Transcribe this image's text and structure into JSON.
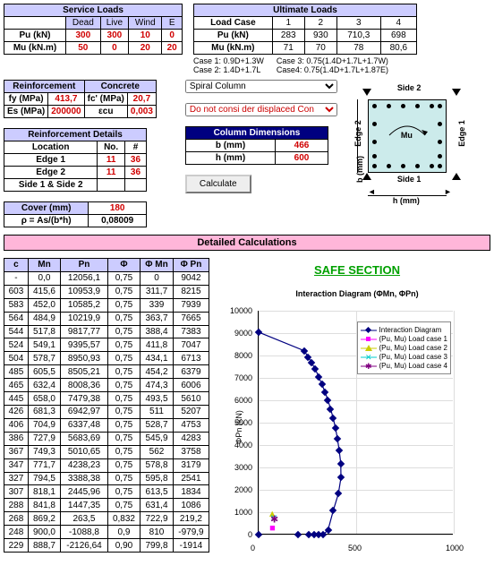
{
  "service": {
    "title": "Service Loads",
    "cols": [
      "Dead",
      "Live",
      "Wind",
      "E"
    ],
    "rows": [
      {
        "k": "Pu (kN)",
        "v": [
          "300",
          "300",
          "10",
          "0"
        ]
      },
      {
        "k": "Mu (kN.m)",
        "v": [
          "50",
          "0",
          "20",
          "20"
        ]
      }
    ]
  },
  "ultimate": {
    "title": "Ultimate Loads",
    "head": "Load Case",
    "cases": [
      "1",
      "2",
      "3",
      "4"
    ],
    "rows": [
      {
        "k": "Pu (kN)",
        "v": [
          "283",
          "930",
          "710,3",
          "698"
        ]
      },
      {
        "k": "Mu (kN.m)",
        "v": [
          "71",
          "70",
          "78",
          "80,6"
        ]
      }
    ]
  },
  "caselbl": [
    {
      "a": "Case 1:",
      "b": "0.9D+1.3W"
    },
    {
      "a": "Case 2:",
      "b": "1.4D+1.7L"
    },
    {
      "a": "Case 3:",
      "b": "0.75(1.4D+1.7L+1.7W)"
    },
    {
      "a": "Case4:",
      "b": "0.75(1.4D+1.7L+1.87E)"
    }
  ],
  "reinf": {
    "t": "Reinforcement",
    "fy": {
      "k": "fy (MPa)",
      "v": "413,7"
    },
    "es": {
      "k": "Es (MPa)",
      "v": "200000"
    }
  },
  "conc": {
    "t": "Concrete",
    "fc": {
      "k": "fc' (MPa)",
      "v": "20,7"
    },
    "ecu": {
      "k": "εcu",
      "v": "0,003"
    }
  },
  "rdet": {
    "t": "Reinforcement Details",
    "h": [
      "Location",
      "No.",
      "#"
    ],
    "rows": [
      {
        "k": "Edge 1",
        "n": "11",
        "d": "36"
      },
      {
        "k": "Edge 2",
        "n": "11",
        "d": "36"
      },
      {
        "k": "Side 1 & Side 2",
        "n": "",
        "d": ""
      }
    ]
  },
  "cover": {
    "k": "Cover (mm)",
    "v": "180"
  },
  "rho": {
    "k": "ρ = As/(b*h)",
    "v": "0,08009"
  },
  "cdim": {
    "t": "Column Dimensions",
    "b": {
      "k": "b (mm)",
      "v": "466"
    },
    "h": {
      "k": "h (mm)",
      "v": "600"
    }
  },
  "sel1": "Spiral Column",
  "sel2": "Do not consi der displaced Con",
  "calc": "Calculate",
  "det": "Detailed Calculations",
  "safe": "SAFE SECTION",
  "fig": {
    "s1": "Side 1",
    "s2": "Side 2",
    "e1": "Edge 1",
    "e2": "Edge 2",
    "mu": "Mu",
    "bm": "b (mm)",
    "hm": "h (mm)"
  },
  "chart_data": {
    "type": "line",
    "title": "Interaction Diagram (ΦMn, ΦPn)",
    "ylabel": "ΦPn (kN)",
    "ylim": [
      0,
      10000
    ],
    "xlim": [
      0,
      1000
    ],
    "yticks": [
      0,
      1000,
      2000,
      3000,
      4000,
      5000,
      6000,
      7000,
      8000,
      9000,
      10000
    ],
    "xticks": [
      0,
      500,
      1000
    ],
    "series": [
      {
        "name": "Interaction Diagram",
        "x": [
          0,
          233,
          254,
          272,
          291,
          308,
          324,
          340,
          355,
          369,
          382,
          394,
          404,
          413,
          421,
          422,
          409,
          383,
          356,
          332,
          307,
          283,
          256,
          203,
          0
        ],
        "y": [
          9042,
          8215,
          7939,
          7665,
          7383,
          7047,
          6713,
          6379,
          6006,
          5610,
          5207,
          4753,
          4283,
          3758,
          3179,
          2541,
          1834,
          1086,
          219,
          0,
          0,
          0,
          0,
          0,
          0
        ]
      },
      {
        "name": "(Pu, Mu) Load case 1",
        "x": [
          71
        ],
        "y": [
          283
        ]
      },
      {
        "name": "(Pu, Mu) Load case 2",
        "x": [
          70
        ],
        "y": [
          930
        ]
      },
      {
        "name": "(Pu, Mu) Load case 3",
        "x": [
          78
        ],
        "y": [
          710
        ]
      },
      {
        "name": "(Pu, Mu) Load case 4",
        "x": [
          81
        ],
        "y": [
          698
        ]
      }
    ],
    "legend": [
      "Interaction Diagram",
      "(Pu, Mu) Load case 1",
      "(Pu, Mu) Load case 2",
      "(Pu, Mu) Load case 3",
      "(Pu, Mu) Load case 4"
    ]
  },
  "table": {
    "head": [
      "c",
      "Mn",
      "Pn",
      "Φ",
      "Φ Mn",
      "Φ Pn"
    ],
    "rows": [
      [
        "-",
        "0,0",
        "12056,1",
        "0,75",
        "0",
        "9042"
      ],
      [
        "603",
        "415,6",
        "10953,9",
        "0,75",
        "311,7",
        "8215"
      ],
      [
        "583",
        "452,0",
        "10585,2",
        "0,75",
        "339",
        "7939"
      ],
      [
        "564",
        "484,9",
        "10219,9",
        "0,75",
        "363,7",
        "7665"
      ],
      [
        "544",
        "517,8",
        "9817,77",
        "0,75",
        "388,4",
        "7383"
      ],
      [
        "524",
        "549,1",
        "9395,57",
        "0,75",
        "411,8",
        "7047"
      ],
      [
        "504",
        "578,7",
        "8950,93",
        "0,75",
        "434,1",
        "6713"
      ],
      [
        "485",
        "605,5",
        "8505,21",
        "0,75",
        "454,2",
        "6379"
      ],
      [
        "465",
        "632,4",
        "8008,36",
        "0,75",
        "474,3",
        "6006"
      ],
      [
        "445",
        "658,0",
        "7479,38",
        "0,75",
        "493,5",
        "5610"
      ],
      [
        "426",
        "681,3",
        "6942,97",
        "0,75",
        "511",
        "5207"
      ],
      [
        "406",
        "704,9",
        "6337,48",
        "0,75",
        "528,7",
        "4753"
      ],
      [
        "386",
        "727,9",
        "5683,69",
        "0,75",
        "545,9",
        "4283"
      ],
      [
        "367",
        "749,3",
        "5010,65",
        "0,75",
        "562",
        "3758"
      ],
      [
        "347",
        "771,7",
        "4238,23",
        "0,75",
        "578,8",
        "3179"
      ],
      [
        "327",
        "794,5",
        "3388,38",
        "0,75",
        "595,8",
        "2541"
      ],
      [
        "307",
        "818,1",
        "2445,96",
        "0,75",
        "613,5",
        "1834"
      ],
      [
        "288",
        "841,8",
        "1447,35",
        "0,75",
        "631,4",
        "1086"
      ],
      [
        "268",
        "869,2",
        "263,5",
        "0,832",
        "722,9",
        "219,2"
      ],
      [
        "248",
        "900,0",
        "-1088,8",
        "0,9",
        "810",
        "-979,9"
      ],
      [
        "229",
        "888,7",
        "-2126,64",
        "0,90",
        "799,8",
        "-1914"
      ]
    ]
  }
}
